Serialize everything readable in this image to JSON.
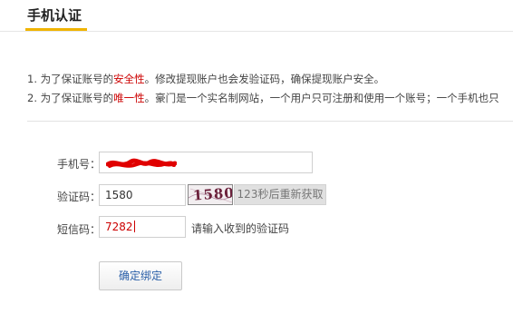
{
  "header": {
    "tab_title": "手机认证"
  },
  "notes": {
    "line1_before": "1. 为了保证账号的",
    "line1_em": "安全性",
    "line1_after": "。修改提现账户也会发验证码，确保提现账户安全。",
    "line2_before": "2. 为了保证账号的",
    "line2_em": "唯一性",
    "line2_after": "。豪门是一个实名制网站，一个用户只可注册和使用一个账号；一个手机也只"
  },
  "form": {
    "phone_label": "手机号：",
    "phone_value": "",
    "verify_label": "验证码：",
    "verify_value": "1580",
    "captcha_text": "1580",
    "resend_label": "123秒后重新获取",
    "sms_label": "短信码：",
    "sms_value": "7282",
    "sms_hint": "请输入收到的验证码",
    "submit_label": "确定绑定"
  },
  "colors": {
    "accent_tab": "#f0b400",
    "highlight": "#cc0000",
    "button_text": "#2a5fa8"
  }
}
